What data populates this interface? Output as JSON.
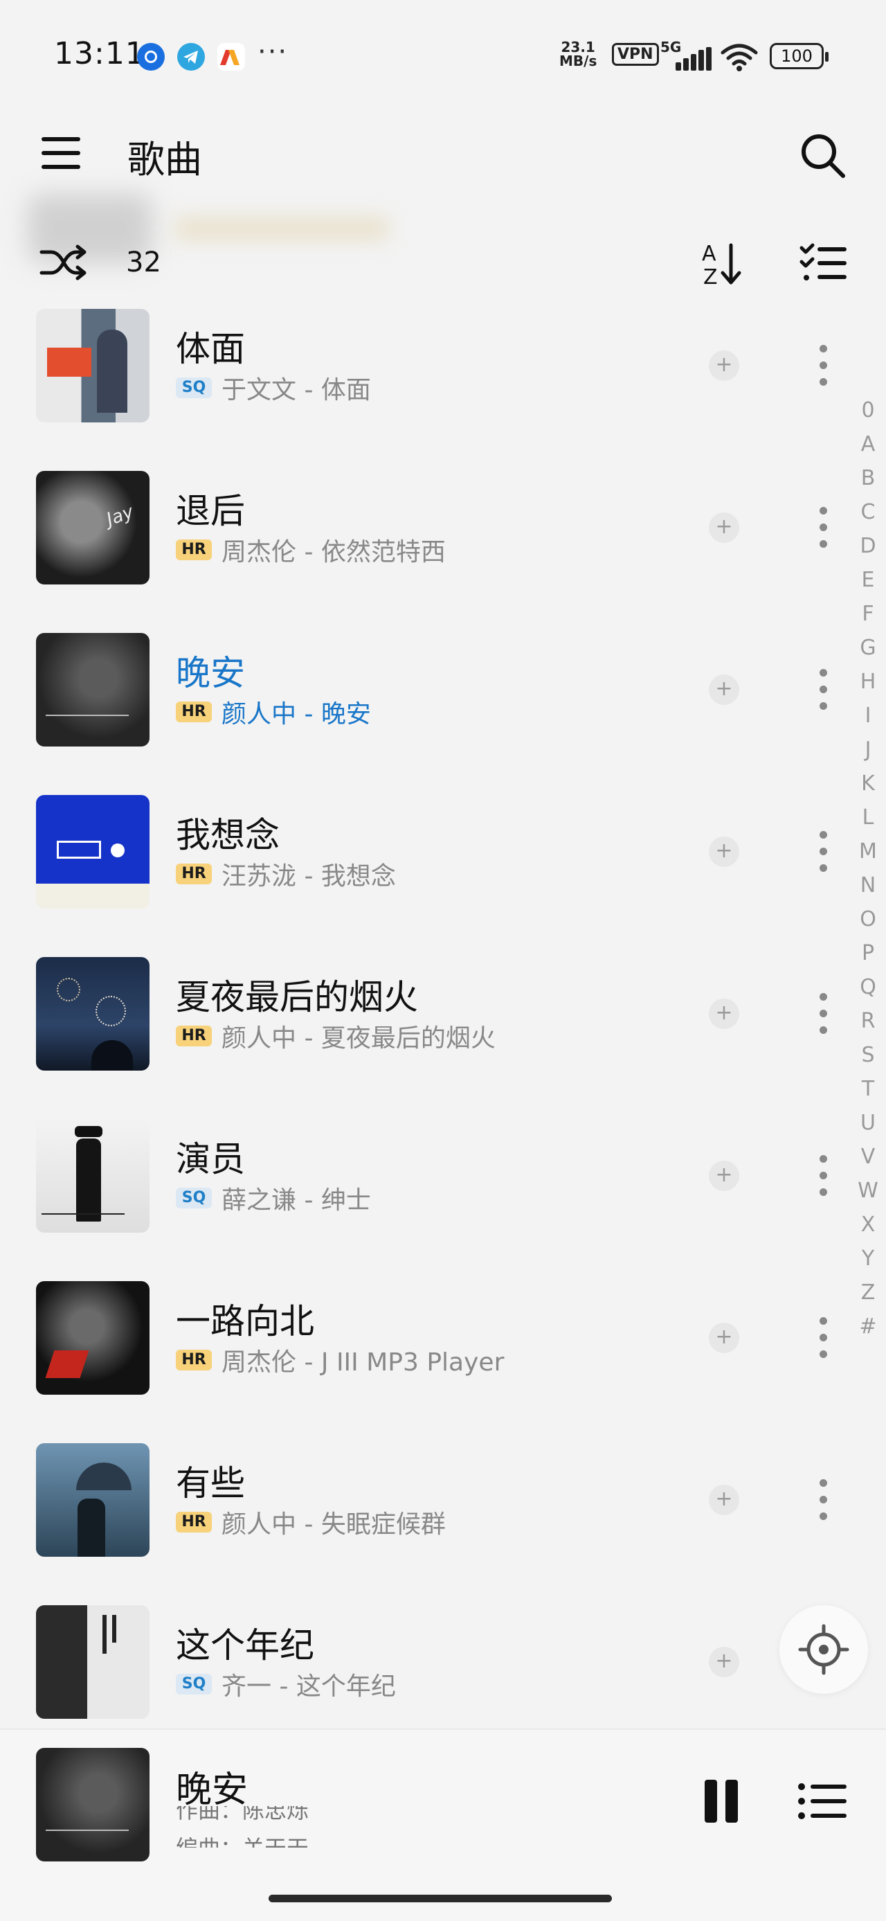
{
  "status_bar": {
    "time": "13:11",
    "more": "···",
    "net_speed_value": "23.1",
    "net_speed_unit": "MB/s",
    "vpn": "VPN",
    "signal": "5G",
    "battery": "100"
  },
  "header": {
    "title": "歌曲"
  },
  "subheader": {
    "count": "32"
  },
  "songs": [
    {
      "title": "体面",
      "quality": "SQ",
      "meta": "于文文 - 体面"
    },
    {
      "title": "退后",
      "quality": "HR",
      "meta": "周杰伦 - 依然范特西"
    },
    {
      "title": "晚安",
      "quality": "HR",
      "meta": "颜人中 - 晚安",
      "playing": true
    },
    {
      "title": "我想念",
      "quality": "HR",
      "meta": "汪苏泷 - 我想念"
    },
    {
      "title": "夏夜最后的烟火",
      "quality": "HR",
      "meta": "颜人中 - 夏夜最后的烟火"
    },
    {
      "title": "演员",
      "quality": "SQ",
      "meta": "薛之谦 - 绅士"
    },
    {
      "title": "一路向北",
      "quality": "HR",
      "meta": "周杰伦 - J III MP3 Player"
    },
    {
      "title": "有些",
      "quality": "HR",
      "meta": "颜人中 - 失眠症候群"
    },
    {
      "title": "这个年纪",
      "quality": "SQ",
      "meta": "齐一 - 这个年纪"
    }
  ],
  "alpha_index": [
    "0",
    "A",
    "B",
    "C",
    "D",
    "E",
    "F",
    "G",
    "H",
    "I",
    "J",
    "K",
    "L",
    "M",
    "N",
    "O",
    "P",
    "Q",
    "R",
    "S",
    "T",
    "U",
    "V",
    "W",
    "X",
    "Y",
    "Z",
    "#"
  ],
  "now_playing": {
    "title": "晚安",
    "lyric_line_1": "作曲：陈忠烁",
    "lyric_line_2": "编曲：关天天"
  },
  "colors": {
    "accent": "#1976c8",
    "hr_badge": "#f7d27a",
    "sq_badge": "#dce8f3"
  }
}
